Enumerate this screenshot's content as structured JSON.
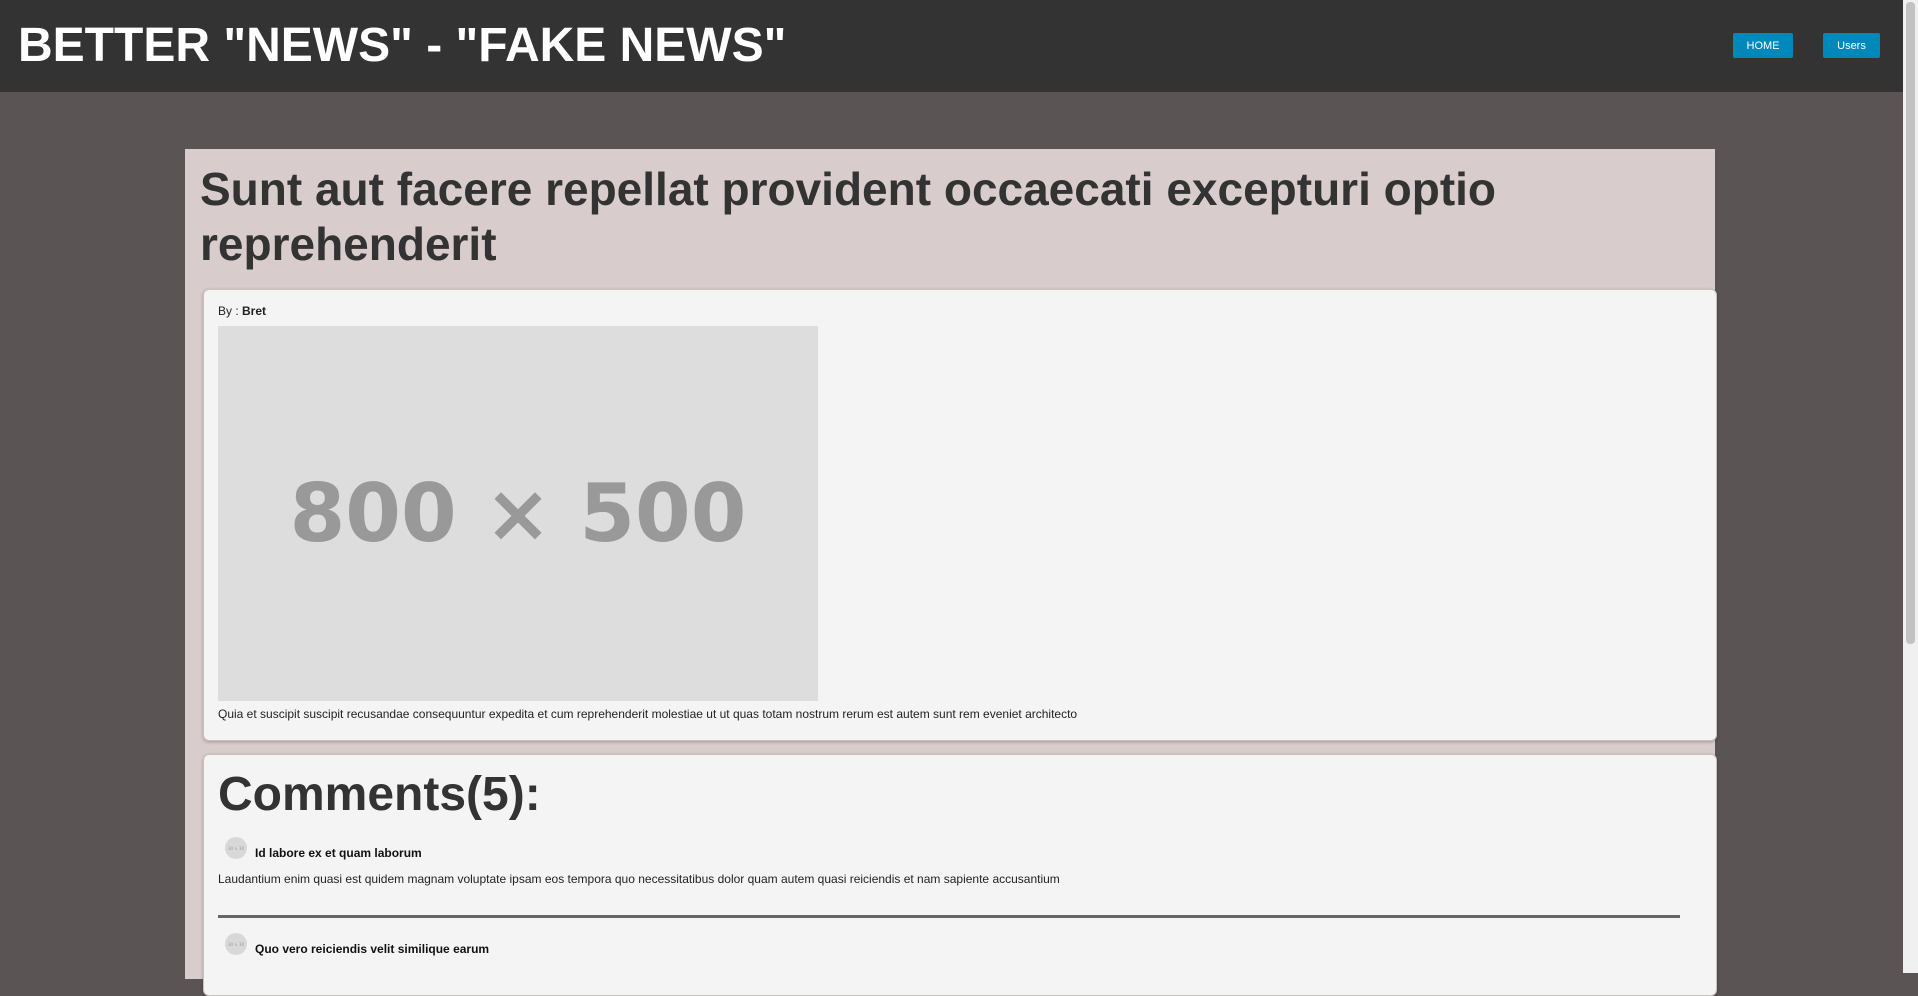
{
  "header": {
    "site_title": "BETTER \"NEWS\" - \"FAKE NEWS\"",
    "nav": [
      {
        "label": "HOME"
      },
      {
        "label": "Users"
      }
    ],
    "accent_color": "#0088bb"
  },
  "article": {
    "title": "Sunt aut facere repellat provident occaecati excepturi optio reprehenderit",
    "author_prefix": "By : ",
    "author": "Bret",
    "image_placeholder": "800 × 500",
    "body": "Quia et suscipit suscipit recusandae consequuntur expedita et cum reprehenderit molestiae ut ut quas totam nostrum rerum est autem sunt rem eveniet architecto"
  },
  "comments": {
    "heading": "Comments(5):",
    "avatar_placeholder": "30 × 30",
    "items": [
      {
        "name": "Id labore ex et quam laborum",
        "body": "Laudantium enim quasi est quidem magnam voluptate ipsam eos tempora quo necessitatibus dolor quam autem quasi reiciendis et nam sapiente accusantium"
      },
      {
        "name": "Quo vero reiciendis velit similique earum"
      }
    ]
  }
}
